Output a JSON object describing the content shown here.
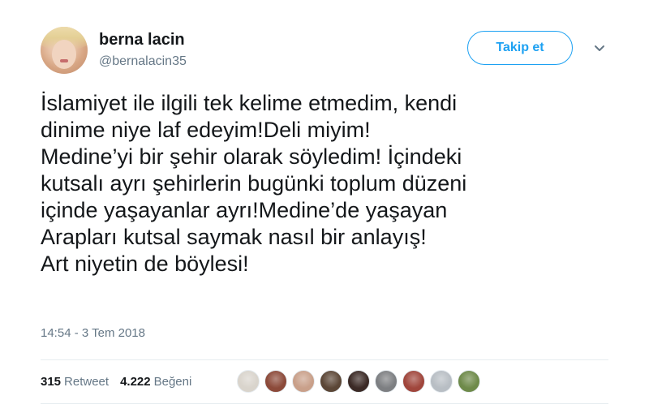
{
  "user": {
    "display_name": "berna lacin",
    "handle": "@bernalacin35",
    "avatar_icon": "profile-photo"
  },
  "follow_button": {
    "label": "Takip et",
    "color": "#1da1f2"
  },
  "more_menu_icon": "chevron-down-icon",
  "tweet": {
    "text_lines": [
      "İslamiyet ile ilgili tek kelime etmedim, kendi",
      "dinime niye laf edeyim!Deli miyim!",
      "Medine’yi bir şehir olarak söyledim! İçindeki",
      "kutsalı ayrı şehirlerin bugünki toplum düzeni",
      "içinde yaşayanlar ayrı!Medine’de yaşayan",
      "Arapları kutsal saymak nasıl bir anlayış!",
      "Art niyetin de böylesi!"
    ],
    "timestamp": "14:54 - 3 Tem 2018"
  },
  "stats": {
    "retweets_count": "315",
    "retweets_label": "Retweet",
    "likes_count": "4.222",
    "likes_label": "Beğeni"
  },
  "likers": [
    {
      "name": "liker-avatar-1",
      "color": "#d9d4cc"
    },
    {
      "name": "liker-avatar-2",
      "color": "#8c4a3a"
    },
    {
      "name": "liker-avatar-3",
      "color": "#c9a08a"
    },
    {
      "name": "liker-avatar-4",
      "color": "#5b4636"
    },
    {
      "name": "liker-avatar-5",
      "color": "#3b2a26"
    },
    {
      "name": "liker-avatar-6",
      "color": "#7d7f82"
    },
    {
      "name": "liker-avatar-7",
      "color": "#a0463c"
    },
    {
      "name": "liker-avatar-8",
      "color": "#b8bec4"
    },
    {
      "name": "liker-avatar-9",
      "color": "#6e8a4a"
    }
  ]
}
